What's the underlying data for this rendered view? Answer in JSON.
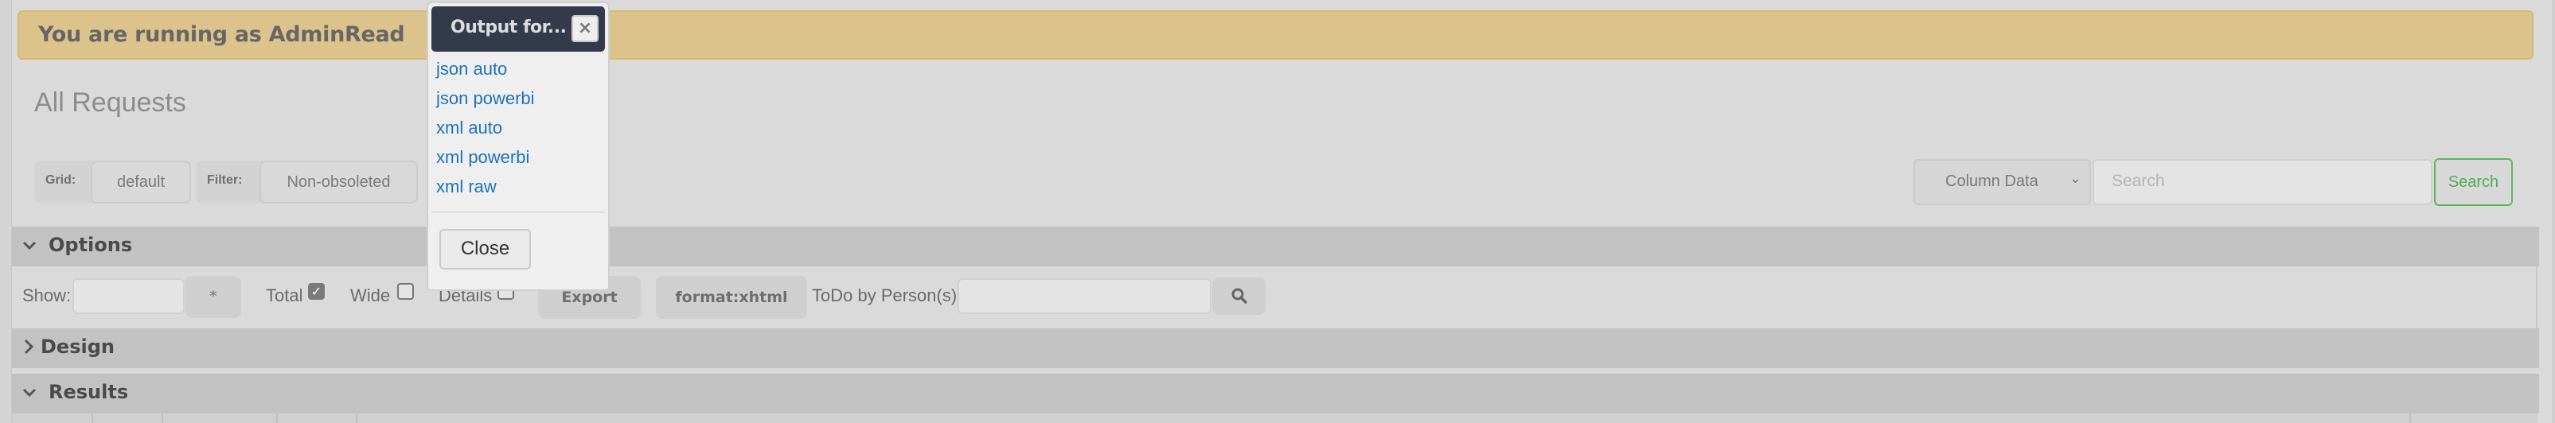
{
  "banner": {
    "text": "You are running as AdminRead"
  },
  "page": {
    "title": "All Requests"
  },
  "toolbar": {
    "grid_label": "Grid:",
    "grid_value": "default",
    "filter_label": "Filter:",
    "filter_value": "Non-obsoleted",
    "column_select": "Column Data",
    "search_placeholder": "Search",
    "search_button": "Search"
  },
  "panels": {
    "options": {
      "title": "Options",
      "expanded": true,
      "show_label": "Show:",
      "show_value": "",
      "star_button": "*",
      "total_label": "Total",
      "total_checked": true,
      "wide_label": "Wide",
      "wide_checked": false,
      "details_label": "Details",
      "details_checked": false,
      "export_button": "Export",
      "format_button": "format:xhtml",
      "todo_label": "ToDo by Person(s)",
      "todo_value": ""
    },
    "design": {
      "title": "Design",
      "expanded": false
    },
    "results": {
      "title": "Results",
      "expanded": true
    }
  },
  "dialog": {
    "title": "Output for...",
    "close_icon": "×",
    "links": [
      "json auto",
      "json powerbi",
      "xml auto",
      "xml powerbi",
      "xml raw"
    ],
    "close_button": "Close"
  },
  "icons": {
    "chevron_down": "⌄",
    "chevron_right": "›",
    "select_chevron": "⌄",
    "checkmark": "✓"
  },
  "colors": {
    "banner_bg": "#dcc38c",
    "dialog_header": "#323a4c",
    "link": "#1e73be",
    "search_button": "#5cb85c"
  }
}
